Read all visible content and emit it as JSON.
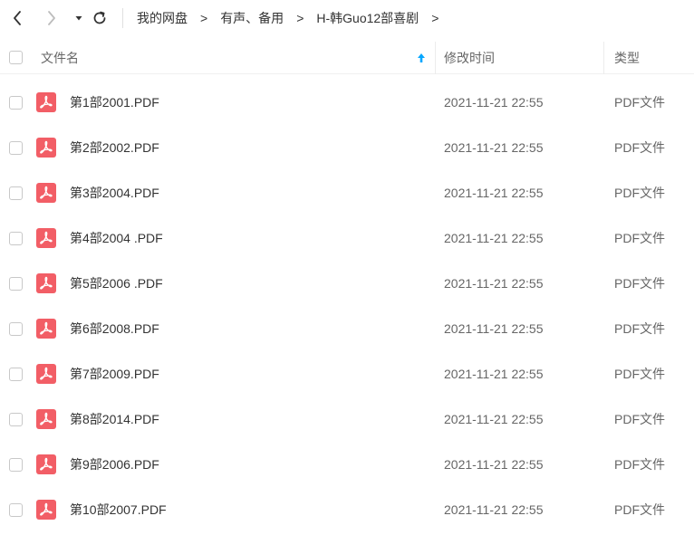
{
  "breadcrumb": {
    "items": [
      "我的网盘",
      "有声、备用",
      "H-韩Guo12部喜剧"
    ],
    "separator": ">"
  },
  "columns": {
    "name": "文件名",
    "modified": "修改时间",
    "type": "类型"
  },
  "sort": {
    "column": "name",
    "direction": "ascending",
    "icon": "arrow-up-icon",
    "color": "#06a7ff"
  },
  "colors": {
    "pdf_icon": "#f25e66",
    "accent": "#06a7ff",
    "text_primary": "#333333",
    "text_secondary": "#666666"
  },
  "files": [
    {
      "name": "第1部2001.PDF",
      "modified": "2021-11-21 22:55",
      "type": "PDF文件"
    },
    {
      "name": "第2部2002.PDF",
      "modified": "2021-11-21 22:55",
      "type": "PDF文件"
    },
    {
      "name": "第3部2004.PDF",
      "modified": "2021-11-21 22:55",
      "type": "PDF文件"
    },
    {
      "name": "第4部2004 .PDF",
      "modified": "2021-11-21 22:55",
      "type": "PDF文件"
    },
    {
      "name": "第5部2006 .PDF",
      "modified": "2021-11-21 22:55",
      "type": "PDF文件"
    },
    {
      "name": "第6部2008.PDF",
      "modified": "2021-11-21 22:55",
      "type": "PDF文件"
    },
    {
      "name": "第7部2009.PDF",
      "modified": "2021-11-21 22:55",
      "type": "PDF文件"
    },
    {
      "name": "第8部2014.PDF",
      "modified": "2021-11-21 22:55",
      "type": "PDF文件"
    },
    {
      "name": "第9部2006.PDF",
      "modified": "2021-11-21 22:55",
      "type": "PDF文件"
    },
    {
      "name": "第10部2007.PDF",
      "modified": "2021-11-21 22:55",
      "type": "PDF文件"
    }
  ]
}
